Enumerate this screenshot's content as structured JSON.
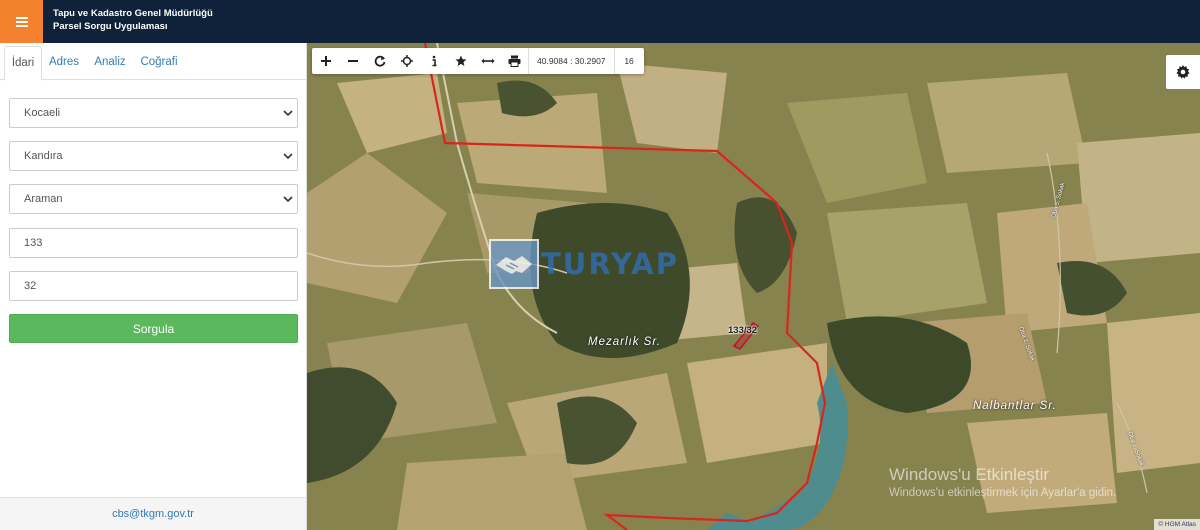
{
  "header": {
    "org_name": "Tapu ve Kadastro Genel Müdürlüğü",
    "app_name": "Parsel Sorgu Uygulaması"
  },
  "tabs": [
    {
      "label": "İdari",
      "active": true
    },
    {
      "label": "Adres",
      "active": false
    },
    {
      "label": "Analiz",
      "active": false
    },
    {
      "label": "Coğrafi",
      "active": false
    }
  ],
  "form": {
    "province": "Kocaeli",
    "district": "Kandıra",
    "neighborhood": "Araman",
    "block_no": "133",
    "parcel_no": "32",
    "query_label": "Sorgula"
  },
  "footer": {
    "email": "cbs@tkgm.gov.tr"
  },
  "map": {
    "coordinates": "40.9084 : 30.2907",
    "zoom_level": "16",
    "tools": [
      "zoom-in-icon",
      "zoom-out-icon",
      "refresh-icon",
      "locate-icon",
      "info-icon",
      "star-icon",
      "measure-icon",
      "print-icon"
    ],
    "place_labels": [
      "Mezarlık Sr.",
      "Nalbantlar Sr."
    ],
    "road_labels": [
      "Oba 5. Sokak",
      "Oba 2. Sokak",
      "Oba 1. Sokak"
    ],
    "parcel_label": "133/32",
    "watermark": "TURYAP",
    "attribution": "© HGM Atlas",
    "boundary_color": "#d9261c",
    "parcel_color": "#c0102a"
  },
  "windows_notice": {
    "title": "Windows'u Etkinleştir",
    "subtitle": "Windows'u etkinleştirmek için Ayarlar'a gidin."
  }
}
